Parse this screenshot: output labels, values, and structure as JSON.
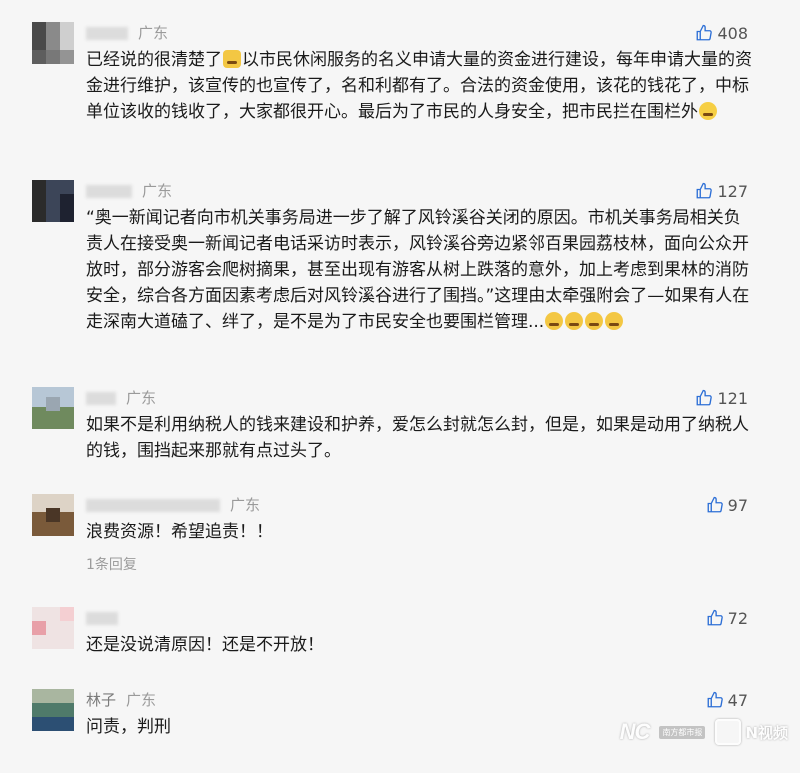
{
  "comments": [
    {
      "region": "广东",
      "likes": "408",
      "text": [
        {
          "t": "已经说的很清楚了"
        },
        {
          "emoji": "cat"
        },
        {
          "t": "以市民休闲服务的名义申请大量的资金进行建设，每年申请大量的资金进行维护，该宣传的也宣传了，名和利都有了。合法的资金使用，该花的钱花了，中标单位该收的钱收了，大家都很开心。最后为了市民的人身安全，把市民拦在围栏外"
        },
        {
          "emoji": "grin"
        }
      ]
    },
    {
      "region": "广东",
      "likes": "127",
      "text": [
        {
          "t": "“奥一新闻记者向市机关事务局进一步了解了风铃溪谷关闭的原因。市机关事务局相关负责人在接受奥一新闻记者电话采访时表示，风铃溪谷旁边紧邻百果园荔枝林，面向公众开放时，部分游客会爬树摘果，甚至出现有游客从树上跌落的意外，加上考虑到果林的消防安全，综合各方面因素考虑后对风铃溪谷进行了围挡。”这理由太牵强附会了—如果有人在走深南大道磕了、绊了，是不是为了市民安全也要围栏管理..."
        },
        {
          "emoji": "sweat"
        },
        {
          "emoji": "sweat"
        },
        {
          "emoji": "sleep"
        },
        {
          "emoji": "sleep"
        }
      ]
    },
    {
      "region": "广东",
      "likes": "121",
      "text": [
        {
          "t": "如果不是利用纳税人的钱来建设和护养，爱怎么封就怎么封，但是，如果是动用了纳税人的钱，围挡起来那就有点过头了。"
        }
      ]
    },
    {
      "region": "广东",
      "likes": "97",
      "text": [
        {
          "t": "浪费资源！希望追责！！"
        }
      ],
      "replies": "1条回复"
    },
    {
      "region": "",
      "likes": "72",
      "text": [
        {
          "t": "还是没说清原因！还是不开放！"
        }
      ]
    },
    {
      "name": "林子",
      "region": "广东",
      "likes": "47",
      "text": [
        {
          "t": "问责，判刑"
        }
      ]
    }
  ],
  "watermark": {
    "brand": "NC",
    "small": "南方都市报",
    "video": "N视频"
  },
  "colors": {
    "background": "#f6f6f6",
    "meta": "#9a9a9a",
    "text": "#1a1a1a"
  }
}
